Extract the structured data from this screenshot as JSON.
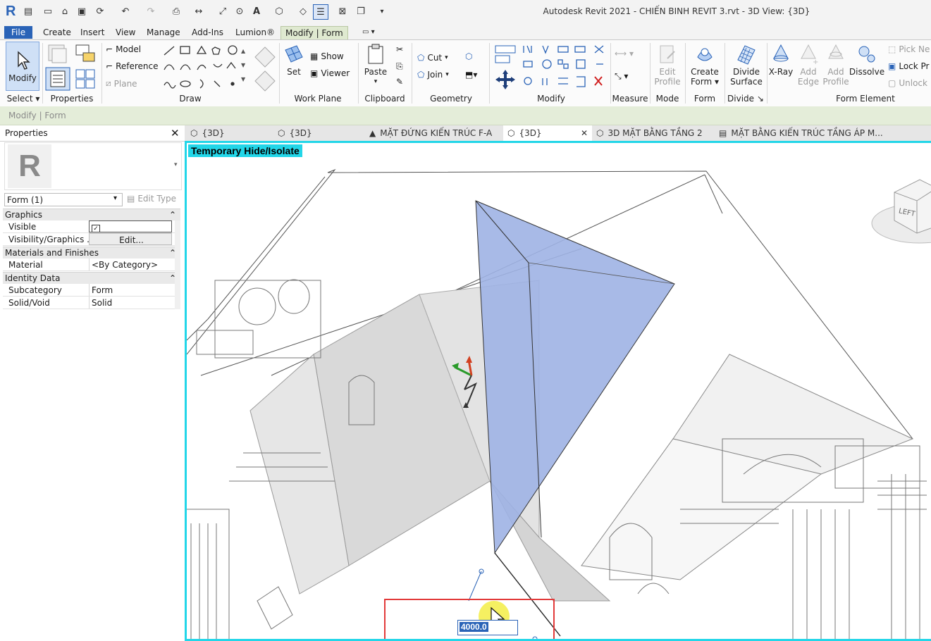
{
  "app": {
    "title": "Autodesk Revit 2021 - CHIẾN BINH REVIT 3.rvt - 3D View: {3D}",
    "logo_letter": "R"
  },
  "menu_tabs": [
    "File",
    "Create",
    "Insert",
    "View",
    "Manage",
    "Add-Ins",
    "Lumion®",
    "Modify | Form"
  ],
  "ribbon": {
    "select": {
      "modify_label": "Modify",
      "panel": "Select"
    },
    "properties": {
      "panel": "Properties"
    },
    "draw": {
      "model": "Model",
      "reference": "Reference",
      "plane": "Plane",
      "panel": "Draw"
    },
    "work_plane": {
      "set": "Set",
      "show": "Show",
      "viewer": "Viewer",
      "panel": "Work Plane"
    },
    "clipboard": {
      "paste": "Paste",
      "panel": "Clipboard"
    },
    "geometry": {
      "cut": "Cut",
      "join": "Join",
      "panel": "Geometry"
    },
    "modify": {
      "panel": "Modify"
    },
    "measure": {
      "panel": "Measure"
    },
    "mode": {
      "edit_profile_1": "Edit",
      "edit_profile_2": "Profile",
      "panel": "Mode"
    },
    "form": {
      "create_1": "Create",
      "create_2": "Form",
      "panel": "Form"
    },
    "divide": {
      "divide_1": "Divide",
      "divide_2": "Surface",
      "panel": "Divide"
    },
    "form_element": {
      "xray": "X-Ray",
      "add_edge_1": "Add",
      "add_edge_2": "Edge",
      "add_profile_1": "Add",
      "add_profile_2": "Profile",
      "dissolve": "Dissolve",
      "pick": "Pick Ne",
      "lock": "Lock Pr",
      "unlock": "Unlock",
      "panel": "Form Element"
    }
  },
  "context_bar": {
    "label": "Modify | Form"
  },
  "properties_panel": {
    "title": "Properties",
    "type_selector": "Form (1)",
    "edit_type": "Edit Type",
    "sections": {
      "graphics": "Graphics",
      "materials": "Materials and Finishes",
      "identity": "Identity Data"
    },
    "rows": {
      "visible_label": "Visible",
      "visibility_label": "Visibility/Graphics ...",
      "visibility_value": "Edit...",
      "material_label": "Material",
      "material_value": "<By Category>",
      "subcategory_label": "Subcategory",
      "subcategory_value": "Form",
      "solidvoid_label": "Solid/Void",
      "solidvoid_value": "Solid"
    }
  },
  "view_tabs": [
    "{3D}",
    "{3D}",
    "MẶT ĐỨNG KIẾN TRÚC F-A",
    "{3D}",
    "3D MẶT BẰNG TẦNG 2",
    "MẶT BẰNG KIẾN TRÚC TẦNG ÁP M..."
  ],
  "canvas": {
    "banner": "Temporary Hide/Isolate",
    "dimension_value": "4000.0",
    "viewcube_face": "LEFT"
  },
  "colors": {
    "accent_blue": "#2a63b7",
    "canvas_border": "#22d6e8",
    "form_face": "#9fb2e4",
    "context_green": "#e4edd9",
    "highlight_red": "#e23a3a",
    "cursor_highlight": "#f3ec3a"
  }
}
